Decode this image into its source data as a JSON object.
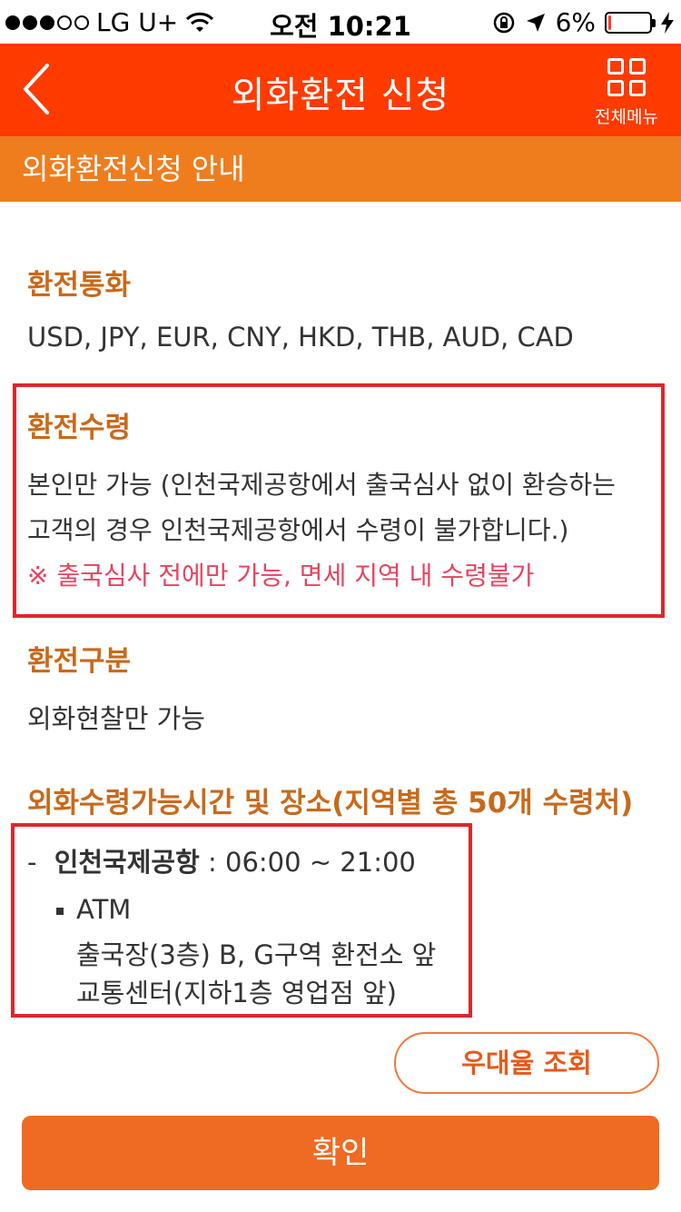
{
  "status_bar": {
    "carrier": "LG U+",
    "time": "오전 10:21",
    "battery": "6%",
    "battery_level": 0.06
  },
  "header": {
    "title": "외화환전 신청",
    "menu_label": "전체메뉴"
  },
  "sub_header": {
    "title": "외화환전신청 안내"
  },
  "sections": {
    "currency": {
      "title": "환전통화",
      "text": "USD, JPY, EUR, CNY, HKD, THB, AUD, CAD"
    },
    "receipt": {
      "title": "환전수령",
      "line1": "본인만 가능 (인천국제공항에서 출국심사 없이 환승하는",
      "line2": "고객의 경우 인천국제공항에서 수령이 불가합니다.)",
      "note": "※ 출국심사 전에만 가능, 면세 지역 내 수령불가"
    },
    "type": {
      "title": "환전구분",
      "text": "외화현찰만 가능"
    },
    "places": {
      "title": "외화수령가능시간 및 장소(지역별 총 50개 수령처)",
      "airport_dash": "-",
      "airport_name": "인천국제공항",
      "airport_hours": " : 06:00 ~ 21:00",
      "atm_label": "ATM",
      "atm_line1": "출국장(3층) B, G구역 환전소 앞",
      "atm_line2": "교통센터(지하1층 영업점 앞)"
    }
  },
  "buttons": {
    "rate_check": "우대율 조회",
    "confirm": "확인"
  }
}
